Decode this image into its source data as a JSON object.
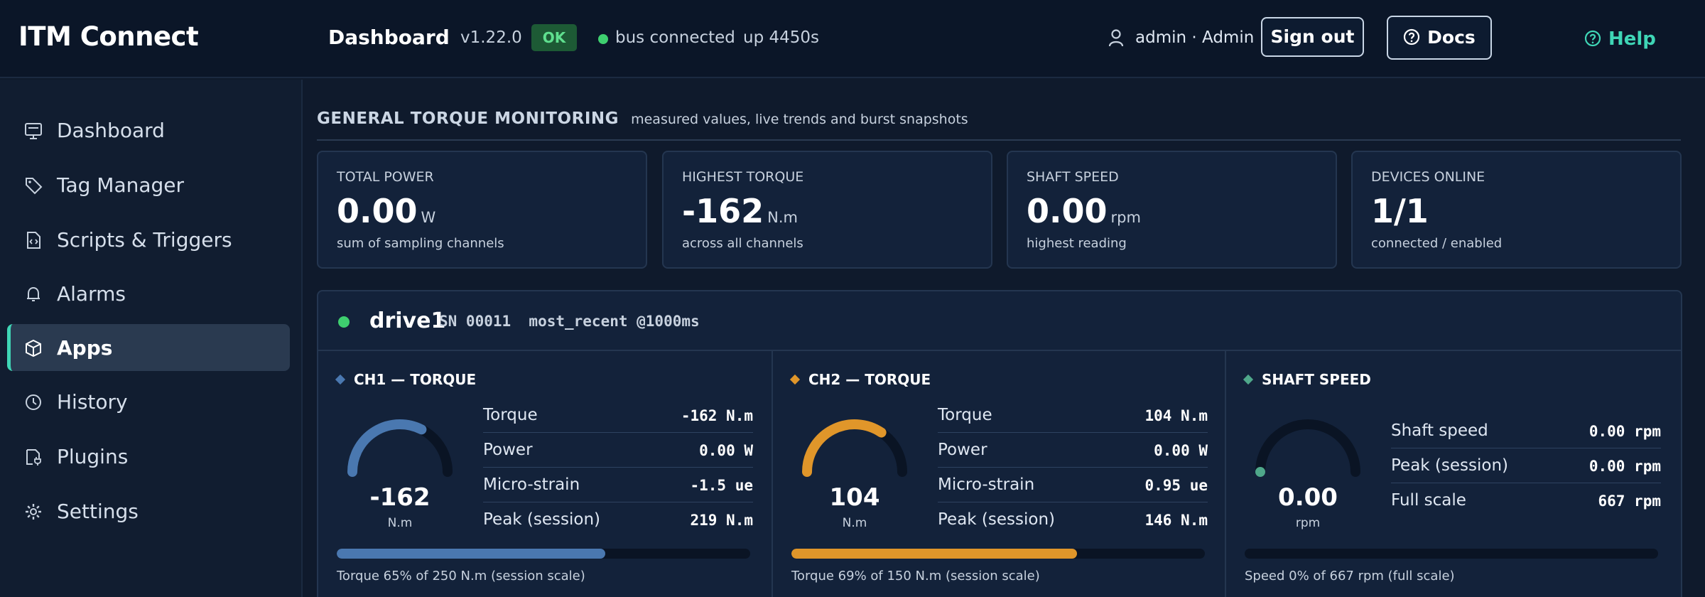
{
  "app": {
    "brand": "ITM Connect"
  },
  "header": {
    "title": "Dashboard",
    "version": "v1.22.0",
    "status_badge": "OK",
    "bus_status": "bus connected",
    "uptime": "up 4450s",
    "user": "admin · Admin",
    "sign_out": "Sign out",
    "docs": "Docs",
    "help": "Help",
    "colors": {
      "ok": "#3ecf6f",
      "accent": "#3fd6b6"
    }
  },
  "sidebar": {
    "items": [
      {
        "label": "Dashboard",
        "icon": "monitor-icon",
        "active": false
      },
      {
        "label": "Tag Manager",
        "icon": "tag-icon",
        "active": false
      },
      {
        "label": "Scripts & Triggers",
        "icon": "script-icon",
        "active": false
      },
      {
        "label": "Alarms",
        "icon": "bell-icon",
        "active": false
      },
      {
        "label": "Apps",
        "icon": "cube-icon",
        "active": true
      },
      {
        "label": "History",
        "icon": "clock-icon",
        "active": false
      },
      {
        "label": "Plugins",
        "icon": "plug-icon",
        "active": false
      },
      {
        "label": "Settings",
        "icon": "gear-icon",
        "active": false
      }
    ]
  },
  "section": {
    "title": "GENERAL TORQUE MONITORING",
    "subtitle": "measured values, live trends and burst snapshots"
  },
  "kpis": [
    {
      "label": "TOTAL POWER",
      "value": "0.00",
      "unit": "W",
      "note": "sum of sampling channels"
    },
    {
      "label": "HIGHEST TORQUE",
      "value": "-162",
      "unit": "N.m",
      "note": "across all channels"
    },
    {
      "label": "SHAFT SPEED",
      "value": "0.00",
      "unit": "rpm",
      "note": "highest reading"
    },
    {
      "label": "DEVICES ONLINE",
      "value": "1/1",
      "unit": "",
      "note": "connected / enabled"
    }
  ],
  "device": {
    "name": "drive1",
    "meta": "SN 00011  most_recent @1000ms",
    "channels": [
      {
        "title": "CH1 — TORQUE",
        "color": "#4a78b0",
        "gauge_value": "-162",
        "gauge_unit": "N.m",
        "gauge_fraction": 0.65,
        "rows": [
          {
            "key": "Torque",
            "value": "-162 N.m"
          },
          {
            "key": "Power",
            "value": "0.00 W"
          },
          {
            "key": "Micro-strain",
            "value": "-1.5 ue"
          },
          {
            "key": "Peak (session)",
            "value": "219 N.m"
          }
        ],
        "bar_fraction": 0.65,
        "caption": "Torque 65% of 250 N.m (session scale)"
      },
      {
        "title": "CH2 — TORQUE",
        "color": "#e0962a",
        "gauge_value": "104",
        "gauge_unit": "N.m",
        "gauge_fraction": 0.69,
        "rows": [
          {
            "key": "Torque",
            "value": "104 N.m"
          },
          {
            "key": "Power",
            "value": "0.00 W"
          },
          {
            "key": "Micro-strain",
            "value": "0.95 ue"
          },
          {
            "key": "Peak (session)",
            "value": "146 N.m"
          }
        ],
        "bar_fraction": 0.69,
        "caption": "Torque 69% of 150 N.m (session scale)"
      },
      {
        "title": "SHAFT SPEED",
        "color": "#4fa88a",
        "gauge_value": "0.00",
        "gauge_unit": "rpm",
        "gauge_fraction": 0.0,
        "rows": [
          {
            "key": "Shaft speed",
            "value": "0.00 rpm"
          },
          {
            "key": "Peak (session)",
            "value": "0.00 rpm"
          },
          {
            "key": "Full scale",
            "value": "667 rpm"
          }
        ],
        "bar_fraction": 0.0,
        "caption": "Speed 0% of 667 rpm (full scale)"
      }
    ]
  }
}
